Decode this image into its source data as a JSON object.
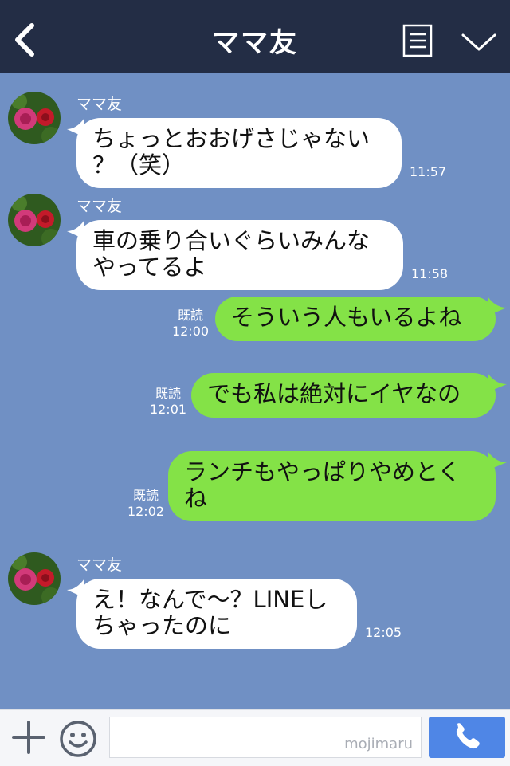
{
  "header": {
    "title": "ママ友",
    "back_icon": "chevron-left-icon",
    "notes_icon": "note-icon",
    "menu_icon": "chevron-down-icon"
  },
  "colors": {
    "header_bg": "#232d45",
    "chat_bg": "#7090c4",
    "incoming_bubble": "#ffffff",
    "outgoing_bubble": "#84e247",
    "call_button": "#4f86e6"
  },
  "messages": [
    {
      "direction": "in",
      "sender": "ママ友",
      "text": "ちょっとおおげさじゃない\n？（笑）",
      "time": "11:57"
    },
    {
      "direction": "in",
      "sender": "ママ友",
      "text": "車の乗り合いぐらいみんな\nやってるよ",
      "time": "11:58"
    },
    {
      "direction": "out",
      "read": "既読",
      "text": "そういう人もいるよね",
      "time": "12:00"
    },
    {
      "direction": "out",
      "read": "既読",
      "text": "でも私は絶対にイヤなの",
      "time": "12:01"
    },
    {
      "direction": "out",
      "read": "既読",
      "text": "ランチもやっぱりやめとく\nね",
      "time": "12:02"
    },
    {
      "direction": "in",
      "sender": "ママ友",
      "text": "え！なんで〜？LINEし\nちゃったのに",
      "time": "12:05"
    }
  ],
  "footer": {
    "plus_icon": "plus-icon",
    "emoji_icon": "smiley-icon",
    "input_value": "",
    "watermark": "mojimaru",
    "call_icon": "phone-icon"
  }
}
